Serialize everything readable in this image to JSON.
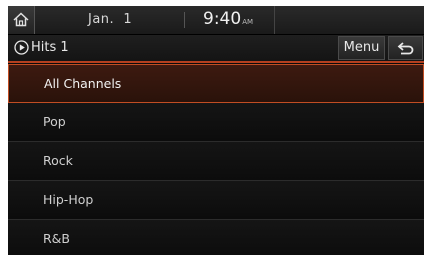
{
  "status_bar": {
    "date": "Jan.  1",
    "time": "9:40",
    "ampm": "AM"
  },
  "title_bar": {
    "title": "Hits 1",
    "menu_label": "Menu"
  },
  "list": {
    "items": [
      {
        "label": "All Channels",
        "selected": true
      },
      {
        "label": "Pop",
        "selected": false
      },
      {
        "label": "Rock",
        "selected": false
      },
      {
        "label": "Hip-Hop",
        "selected": false
      },
      {
        "label": "R&B",
        "selected": false
      }
    ]
  },
  "colors": {
    "accent": "#c24d23",
    "background": "#0b0b0b"
  }
}
